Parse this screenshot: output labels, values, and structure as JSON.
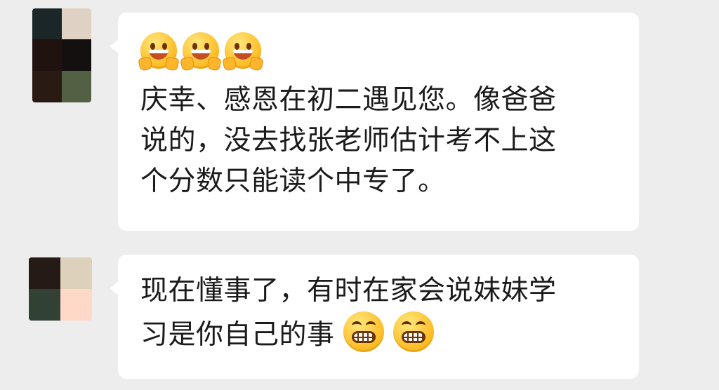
{
  "chat": {
    "messages": [
      {
        "lines": [
          "庆幸、感恩在初二遇见您。像爸爸",
          "说的，没去找张老师估计考不上这",
          "个分数只能读个中专了。"
        ],
        "leading_emojis": [
          "peace-sign-smile-emoji",
          "peace-sign-smile-emoji",
          "peace-sign-smile-emoji"
        ],
        "avatar_colors": [
          "#1b2629",
          "#dfd1c3",
          "#20120f",
          "#151010",
          "#2a1a14",
          "#526044"
        ]
      },
      {
        "lines": [
          "现在懂事了，有时在家会说妹妹学",
          "习是你自己的事"
        ],
        "trailing_emojis": [
          "grinning-face-emoji",
          "grinning-face-emoji"
        ],
        "avatar_colors": [
          "#251a15",
          "#ded1bb",
          "#314133",
          "#ffd8c8"
        ]
      }
    ]
  },
  "colors": {
    "background": "#ededed",
    "bubble": "#ffffff",
    "text": "#1b1b1b",
    "emoji_yellow": "#ffc83d"
  }
}
